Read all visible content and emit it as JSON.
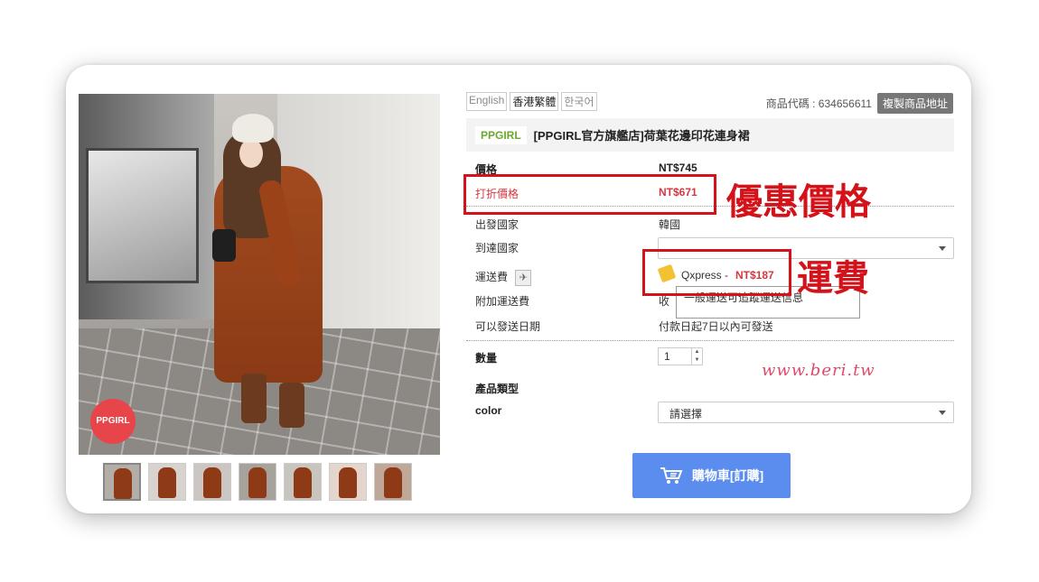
{
  "lang": [
    "English",
    "香港繁體",
    "한국어"
  ],
  "product_code_label": "商品代碼 : 634656611",
  "copy_button": "複製商品地址",
  "brand": "PPGIRL",
  "title": "[PPGIRL官方旗艦店]荷葉花邊印花連身裙",
  "photo_logo": "PPGIRL",
  "rows": {
    "price_label": "價格",
    "price_value": "NT$745",
    "discount_label": "打折價格",
    "discount_value": "NT$671",
    "origin_label": "出發國家",
    "origin_value": "韓國",
    "dest_label": "到達國家",
    "dest_value": "",
    "shipping_label": "運送費",
    "shipping_plane": "✈",
    "shipping_method": "Qxpress -",
    "shipping_price": "NT$187",
    "extra_label": "附加運送費",
    "extra_value_partial": "收",
    "tooltip": "一般運送可追蹤運送信息",
    "ship_date_label": "可以發送日期",
    "ship_date_value": "付款日起7日以內可發送",
    "qty_label": "數量",
    "qty_value": "1",
    "type_label": "產品類型",
    "color_label": "color",
    "color_select": "請選擇"
  },
  "cart_button": "購物車[訂購]",
  "watermark": "www.beri.tw",
  "annotations": {
    "discount_note": "優惠價格",
    "shipping_note": "運費"
  },
  "colors": {
    "accent_red": "#d6373f",
    "annotation_red": "#d4121a",
    "cart_blue": "#5b8def",
    "brand_green": "#6aa82a"
  }
}
